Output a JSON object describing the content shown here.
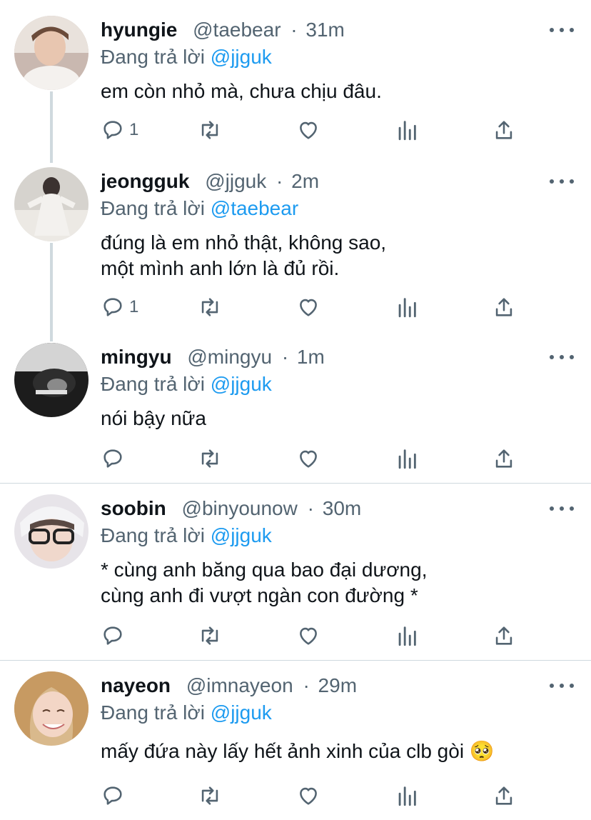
{
  "tweets": [
    {
      "name": "hyungie",
      "handle": "@taebear",
      "sep": "·",
      "time": "31m",
      "replying_label": "Đang trả lời",
      "replying_to": "@jjguk",
      "lines": [
        "em còn nhỏ mà, chưa chịu đâu."
      ],
      "reply_count": "1"
    },
    {
      "name": "jeongguk",
      "handle": "@jjguk",
      "sep": "·",
      "time": "2m",
      "replying_label": "Đang trả lời",
      "replying_to": "@taebear",
      "lines": [
        "đúng là em nhỏ thật, không sao,",
        "một mình anh lớn là đủ rồi."
      ],
      "reply_count": "1"
    },
    {
      "name": "mingyu",
      "handle": "@mingyu",
      "sep": "·",
      "time": "1m",
      "replying_label": "Đang trả lời",
      "replying_to": "@jjguk",
      "lines": [
        "nói bậy nữa"
      ],
      "reply_count": ""
    },
    {
      "name": "soobin",
      "handle": "@binyounow",
      "sep": "·",
      "time": "30m",
      "replying_label": "Đang trả lời",
      "replying_to": "@jjguk",
      "lines": [
        "* cùng anh băng qua bao đại dương,",
        "cùng anh đi vượt ngàn con đường *"
      ],
      "reply_count": ""
    },
    {
      "name": "nayeon",
      "handle": "@imnayeon",
      "sep": "·",
      "time": "29m",
      "replying_label": "Đang trả lời",
      "replying_to": "@jjguk",
      "lines": [
        "mấy đứa này lấy hết ảnh xinh của clb gòi 🥺"
      ],
      "reply_count": ""
    }
  ],
  "icons": {
    "reply": "reply-icon",
    "retweet": "retweet-icon",
    "like": "like-icon",
    "analytics": "analytics-icon",
    "share": "share-icon",
    "more": "more-icon"
  },
  "colors": {
    "text": "#0f1419",
    "secondary": "#536471",
    "accent": "#1d9bf0",
    "line": "#cfd9de"
  }
}
